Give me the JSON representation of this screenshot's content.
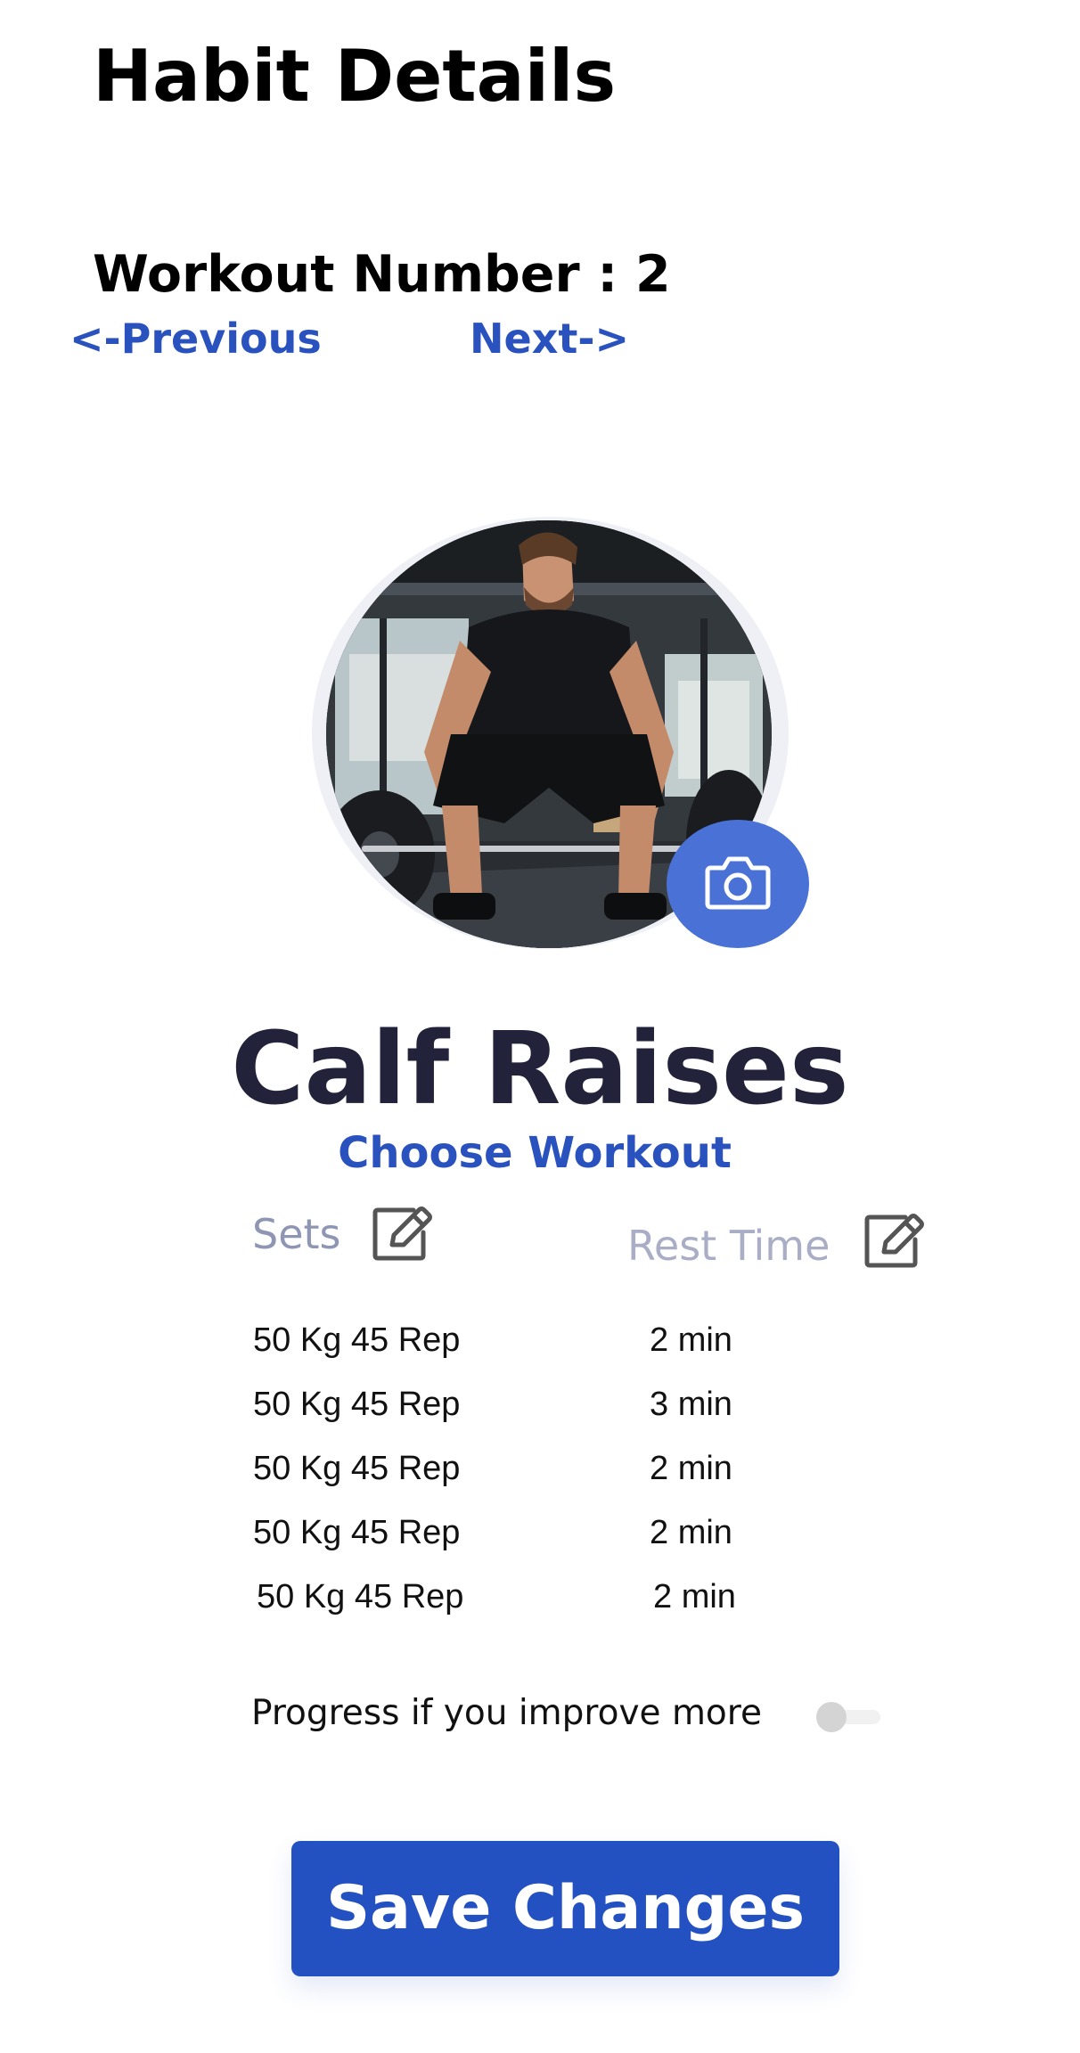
{
  "header": {
    "title": "Habit Details"
  },
  "workout": {
    "number_label": "Workout Number : 2",
    "previous_label": "<-Previous",
    "next_label": "Next->",
    "name": "Calf Raises",
    "choose_label": "Choose Workout"
  },
  "table": {
    "sets_header": "Sets",
    "rest_header": "Rest Time",
    "rows": [
      {
        "set": "50 Kg 45 Rep",
        "rest": "2 min"
      },
      {
        "set": "50 Kg 45 Rep",
        "rest": "3 min"
      },
      {
        "set": "50 Kg 45 Rep",
        "rest": "2 min"
      },
      {
        "set": "50 Kg 45 Rep",
        "rest": "2 min"
      },
      {
        "set": "50 Kg 45 Rep",
        "rest": "2 min"
      }
    ]
  },
  "progress": {
    "label": "Progress if you improve more",
    "enabled": false
  },
  "actions": {
    "save_label": "Save Changes"
  },
  "icons": {
    "camera": "camera-icon",
    "edit": "edit-icon"
  },
  "colors": {
    "accent": "#2351c2",
    "link": "#2a52be",
    "camera_button": "#4a72d6",
    "title_dark": "#22223a",
    "muted_header": "#8e96b4"
  }
}
